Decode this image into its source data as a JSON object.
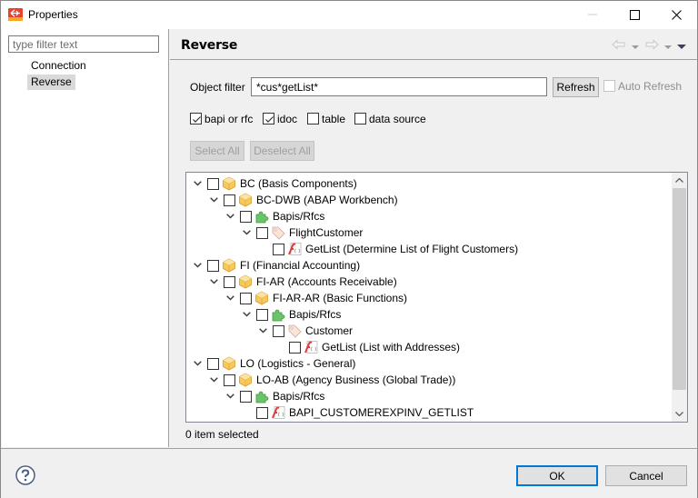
{
  "window": {
    "title": "Properties",
    "controls": [
      "minimize",
      "maximize",
      "close"
    ]
  },
  "sidebar": {
    "filter_placeholder": "type filter text",
    "filter_value": "",
    "items": [
      {
        "label": "Connection",
        "selected": false
      },
      {
        "label": "Reverse",
        "selected": true
      }
    ]
  },
  "panel": {
    "title": "Reverse",
    "nav": [
      "back-arrow-icon",
      "back-menu-icon",
      "forward-arrow-icon",
      "forward-menu-icon",
      "view-menu-icon"
    ]
  },
  "filter": {
    "label": "Object filter",
    "value": "*cus*getList*",
    "refresh_label": "Refresh",
    "auto_refresh_label": "Auto Refresh",
    "auto_refresh_checked": false
  },
  "types": [
    {
      "label": "bapi or rfc",
      "checked": true
    },
    {
      "label": "idoc",
      "checked": true
    },
    {
      "label": "table",
      "checked": false
    },
    {
      "label": "data source",
      "checked": false
    }
  ],
  "actions": {
    "select_all": "Select All",
    "deselect_all": "Deselect All"
  },
  "tree": [
    {
      "level": 0,
      "expanded": true,
      "icon": "package-icon",
      "label": "BC (Basis Components)",
      "checked": false
    },
    {
      "level": 1,
      "expanded": true,
      "icon": "package-icon",
      "label": "BC-DWB (ABAP Workbench)",
      "checked": false
    },
    {
      "level": 2,
      "expanded": true,
      "icon": "puzzle-icon",
      "label": "Bapis/Rfcs",
      "checked": false
    },
    {
      "level": 3,
      "expanded": true,
      "icon": "tag-icon",
      "label": "FlightCustomer",
      "checked": false
    },
    {
      "level": 4,
      "expanded": null,
      "icon": "function-icon",
      "label": "GetList (Determine List of Flight Customers)",
      "checked": false
    },
    {
      "level": 0,
      "expanded": true,
      "icon": "package-icon",
      "label": "FI (Financial Accounting)",
      "checked": false
    },
    {
      "level": 1,
      "expanded": true,
      "icon": "package-icon",
      "label": "FI-AR (Accounts Receivable)",
      "checked": false
    },
    {
      "level": 2,
      "expanded": true,
      "icon": "package-icon",
      "label": "FI-AR-AR (Basic Functions)",
      "checked": false
    },
    {
      "level": 3,
      "expanded": true,
      "icon": "puzzle-icon",
      "label": "Bapis/Rfcs",
      "checked": false
    },
    {
      "level": 4,
      "expanded": true,
      "icon": "tag-icon",
      "label": "Customer",
      "checked": false
    },
    {
      "level": 5,
      "expanded": null,
      "icon": "function-icon",
      "label": "GetList (List with Addresses)",
      "checked": false
    },
    {
      "level": 0,
      "expanded": true,
      "icon": "package-icon",
      "label": "LO (Logistics - General)",
      "checked": false
    },
    {
      "level": 1,
      "expanded": true,
      "icon": "package-icon",
      "label": "LO-AB (Agency Business (Global Trade))",
      "checked": false
    },
    {
      "level": 2,
      "expanded": true,
      "icon": "puzzle-icon",
      "label": "Bapis/Rfcs",
      "checked": false
    },
    {
      "level": 3,
      "expanded": null,
      "icon": "function-icon",
      "label": "BAPI_CUSTOMEREXPINV_GETLIST",
      "checked": false
    }
  ],
  "status": "0 item selected",
  "footer": {
    "ok_label": "OK",
    "cancel_label": "Cancel"
  },
  "colors": {
    "accent": "#0078d7",
    "selected_bg": "#d9d9d9",
    "package": "#f2c14e",
    "puzzle": "#5cb85c",
    "function": "#e03a3a"
  }
}
